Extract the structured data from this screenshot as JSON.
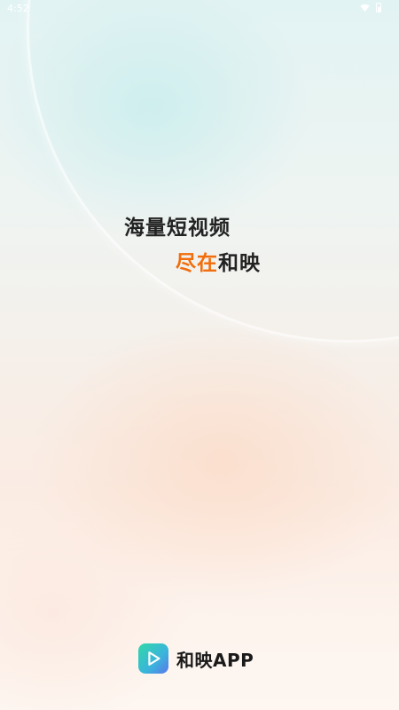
{
  "status_bar": {
    "time": "4:52",
    "icons": [
      "wifi-icon",
      "battery-icon"
    ]
  },
  "slogan": {
    "line1": "海量短视频",
    "line2_highlight": "尽在",
    "line2_rest": "和映"
  },
  "brand": {
    "logo_icon": "play-logo-icon",
    "name": "和映APP"
  },
  "colors": {
    "highlight": "#f26d0c",
    "text_dark": "#222222",
    "logo_gradient_start": "#31d8a9",
    "logo_gradient_end": "#5a78ea"
  }
}
